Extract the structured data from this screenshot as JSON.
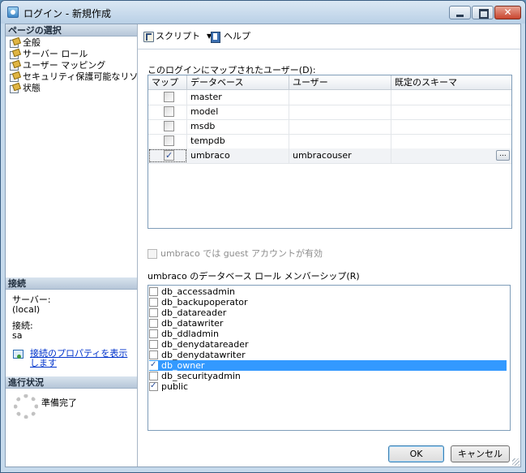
{
  "window": {
    "title": "ログイン - 新規作成"
  },
  "left_pane": {
    "pages_header": "ページの選択",
    "pages": [
      {
        "label": "全般"
      },
      {
        "label": "サーバー ロール"
      },
      {
        "label": "ユーザー マッピング"
      },
      {
        "label": "セキュリティ保護可能なリソース"
      },
      {
        "label": "状態"
      }
    ],
    "connection_header": "接続",
    "server_label": "サーバー:",
    "server_value": "(local)",
    "conn_label": "接続:",
    "conn_value": "sa",
    "view_props_link": "接続のプロパティを表示します",
    "progress_header": "進行状況",
    "progress_status": "準備完了"
  },
  "toolbar": {
    "script_label": "スクリプト",
    "help_label": "ヘルプ"
  },
  "mapping": {
    "label": "このログインにマップされたユーザー(D):",
    "columns": [
      "マップ",
      "データベース",
      "ユーザー",
      "既定のスキーマ"
    ],
    "rows": [
      {
        "map": false,
        "database": "master",
        "user": "",
        "schema": ""
      },
      {
        "map": false,
        "database": "model",
        "user": "",
        "schema": ""
      },
      {
        "map": false,
        "database": "msdb",
        "user": "",
        "schema": ""
      },
      {
        "map": false,
        "database": "tempdb",
        "user": "",
        "schema": ""
      },
      {
        "map": true,
        "database": "umbraco",
        "user": "umbracouser",
        "schema": "",
        "ellipsis": "..."
      }
    ]
  },
  "guest_label": "umbraco では guest アカウントが有効",
  "roles": {
    "label": "umbraco のデータベース ロール メンバーシップ(R)",
    "items": [
      {
        "name": "db_accessadmin",
        "checked": false
      },
      {
        "name": "db_backupoperator",
        "checked": false
      },
      {
        "name": "db_datareader",
        "checked": false
      },
      {
        "name": "db_datawriter",
        "checked": false
      },
      {
        "name": "db_ddladmin",
        "checked": false
      },
      {
        "name": "db_denydatareader",
        "checked": false
      },
      {
        "name": "db_denydatawriter",
        "checked": false
      },
      {
        "name": "db_owner",
        "checked": true
      },
      {
        "name": "db_securityadmin",
        "checked": false
      },
      {
        "name": "public",
        "checked": true
      }
    ]
  },
  "buttons": {
    "ok": "OK",
    "cancel": "キャンセル"
  }
}
